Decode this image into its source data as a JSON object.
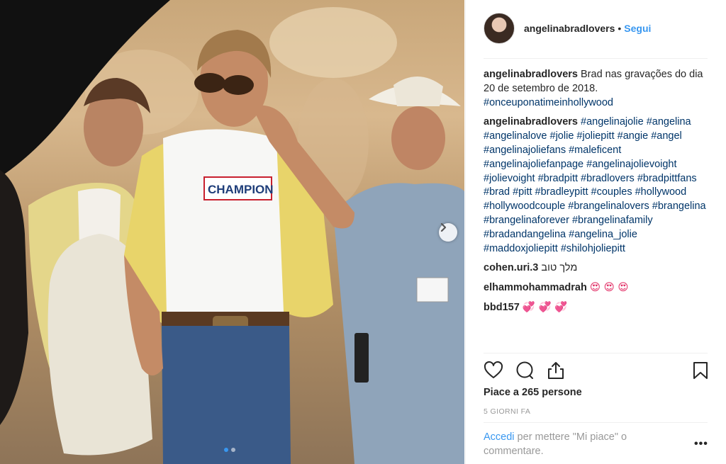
{
  "post": {
    "username": "angelinabradlovers",
    "separator": "•",
    "follow_label": "Segui"
  },
  "comments": [
    {
      "user": "angelinabradlovers",
      "text": "Brad nas gravações do dia 20 de setembro de 2018.",
      "hashtags": "#onceuponatimeinhollywood"
    },
    {
      "user": "angelinabradlovers",
      "text": "",
      "hashtags": "#angelinajolie #angelina #angelinalove #jolie #joliepitt #angie #angel #angelinajoliefans #maleficent #angelinajoliefanpage #angelinajolievoight #jolievoight #bradpitt #bradlovers #bradpittfans #brad #pitt #bradleypitt #couples #hollywood #hollywoodcouple #brangelinalovers #brangelina #brangelinaforever #brangelinafamily #bradandangelina #angelina_jolie #maddoxjoliepitt #shilohjoliepitt"
    },
    {
      "user": "cohen.uri.3",
      "text": "מלך טוב",
      "hashtags": ""
    },
    {
      "user": "elhammohammadrah",
      "text": "😍 😍 😍",
      "hashtags": ""
    },
    {
      "user": "bbd157",
      "text": "💞 💞 💞",
      "hashtags": ""
    }
  ],
  "actions": {
    "icons": [
      "heart-icon",
      "comment-icon",
      "share-icon",
      "bookmark-icon"
    ],
    "likes_text": "Piace a 265 persone",
    "time_text": "5 GIORNI FA"
  },
  "login": {
    "link_text": "Accedi",
    "rest_text": " per mettere \"Mi piace\" o commentare.",
    "more_label": "•••"
  },
  "carousel": {
    "total": 2,
    "active": 1
  },
  "colors": {
    "link": "#3897f0",
    "hashtag": "#003569",
    "muted": "#999999",
    "text": "#262626",
    "border": "#efefef"
  }
}
